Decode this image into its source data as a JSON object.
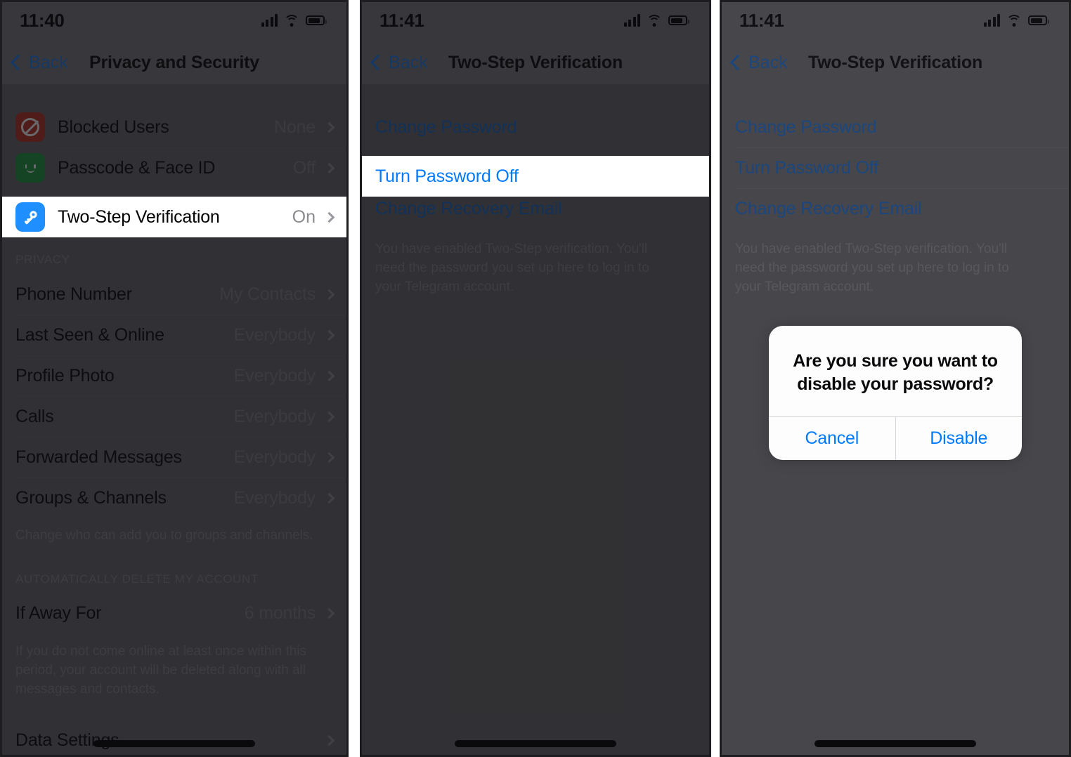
{
  "panel1": {
    "status": {
      "time": "11:40",
      "signal_icon": "cellular-bars-icon",
      "wifi_icon": "wifi-icon",
      "battery_icon": "battery-icon"
    },
    "nav": {
      "back_label": "Back",
      "title": "Privacy and Security"
    },
    "security_rows": [
      {
        "icon": "blocked-users-icon",
        "label": "Blocked Users",
        "value": "None"
      },
      {
        "icon": "face-id-icon",
        "label": "Passcode & Face ID",
        "value": "Off"
      },
      {
        "icon": "key-icon",
        "label": "Two-Step Verification",
        "value": "On",
        "highlighted": true
      }
    ],
    "privacy_header": "PRIVACY",
    "privacy_rows": [
      {
        "label": "Phone Number",
        "value": "My Contacts"
      },
      {
        "label": "Last Seen & Online",
        "value": "Everybody"
      },
      {
        "label": "Profile Photo",
        "value": "Everybody"
      },
      {
        "label": "Calls",
        "value": "Everybody"
      },
      {
        "label": "Forwarded Messages",
        "value": "Everybody"
      },
      {
        "label": "Groups & Channels",
        "value": "Everybody"
      }
    ],
    "privacy_footnote": "Change who can add you to groups and channels.",
    "delete_header": "AUTOMATICALLY DELETE MY ACCOUNT",
    "delete_rows": [
      {
        "label": "If Away For",
        "value": "6 months"
      }
    ],
    "delete_footnote": "If you do not come online at least once within this period, your account will be deleted along with all messages and contacts.",
    "last_row": {
      "label": "Data Settings",
      "value": ""
    }
  },
  "panel2": {
    "status": {
      "time": "11:41",
      "signal_icon": "cellular-bars-icon",
      "wifi_icon": "wifi-icon",
      "battery_icon": "battery-icon"
    },
    "nav": {
      "back_label": "Back",
      "title": "Two-Step Verification"
    },
    "links": [
      {
        "label": "Change Password",
        "highlighted": false
      },
      {
        "label": "Turn Password Off",
        "highlighted": true
      },
      {
        "label": "Change Recovery Email",
        "highlighted": false
      }
    ],
    "footnote": "You have enabled Two-Step verification. You'll need the password you set up here to log in to your Telegram account."
  },
  "panel3": {
    "status": {
      "time": "11:41",
      "signal_icon": "cellular-bars-icon",
      "wifi_icon": "wifi-icon",
      "battery_icon": "battery-icon"
    },
    "nav": {
      "back_label": "Back",
      "title": "Two-Step Verification"
    },
    "links": [
      {
        "label": "Change Password"
      },
      {
        "label": "Turn Password Off"
      },
      {
        "label": "Change Recovery Email"
      }
    ],
    "footnote": "You have enabled Two-Step verification. You'll need the password you set up here to log in to your Telegram account.",
    "alert": {
      "title": "Are you sure you want to disable your password?",
      "cancel_label": "Cancel",
      "confirm_label": "Disable"
    }
  },
  "colors": {
    "ios_blue": "#007AFF",
    "dimmed_blue": "#1f6fd0",
    "blocked_red": "#c0392b",
    "faceid_green": "#24a148",
    "key_blue": "#1f8fff",
    "dim_dark": "#424245",
    "dim_light": "#757579"
  }
}
